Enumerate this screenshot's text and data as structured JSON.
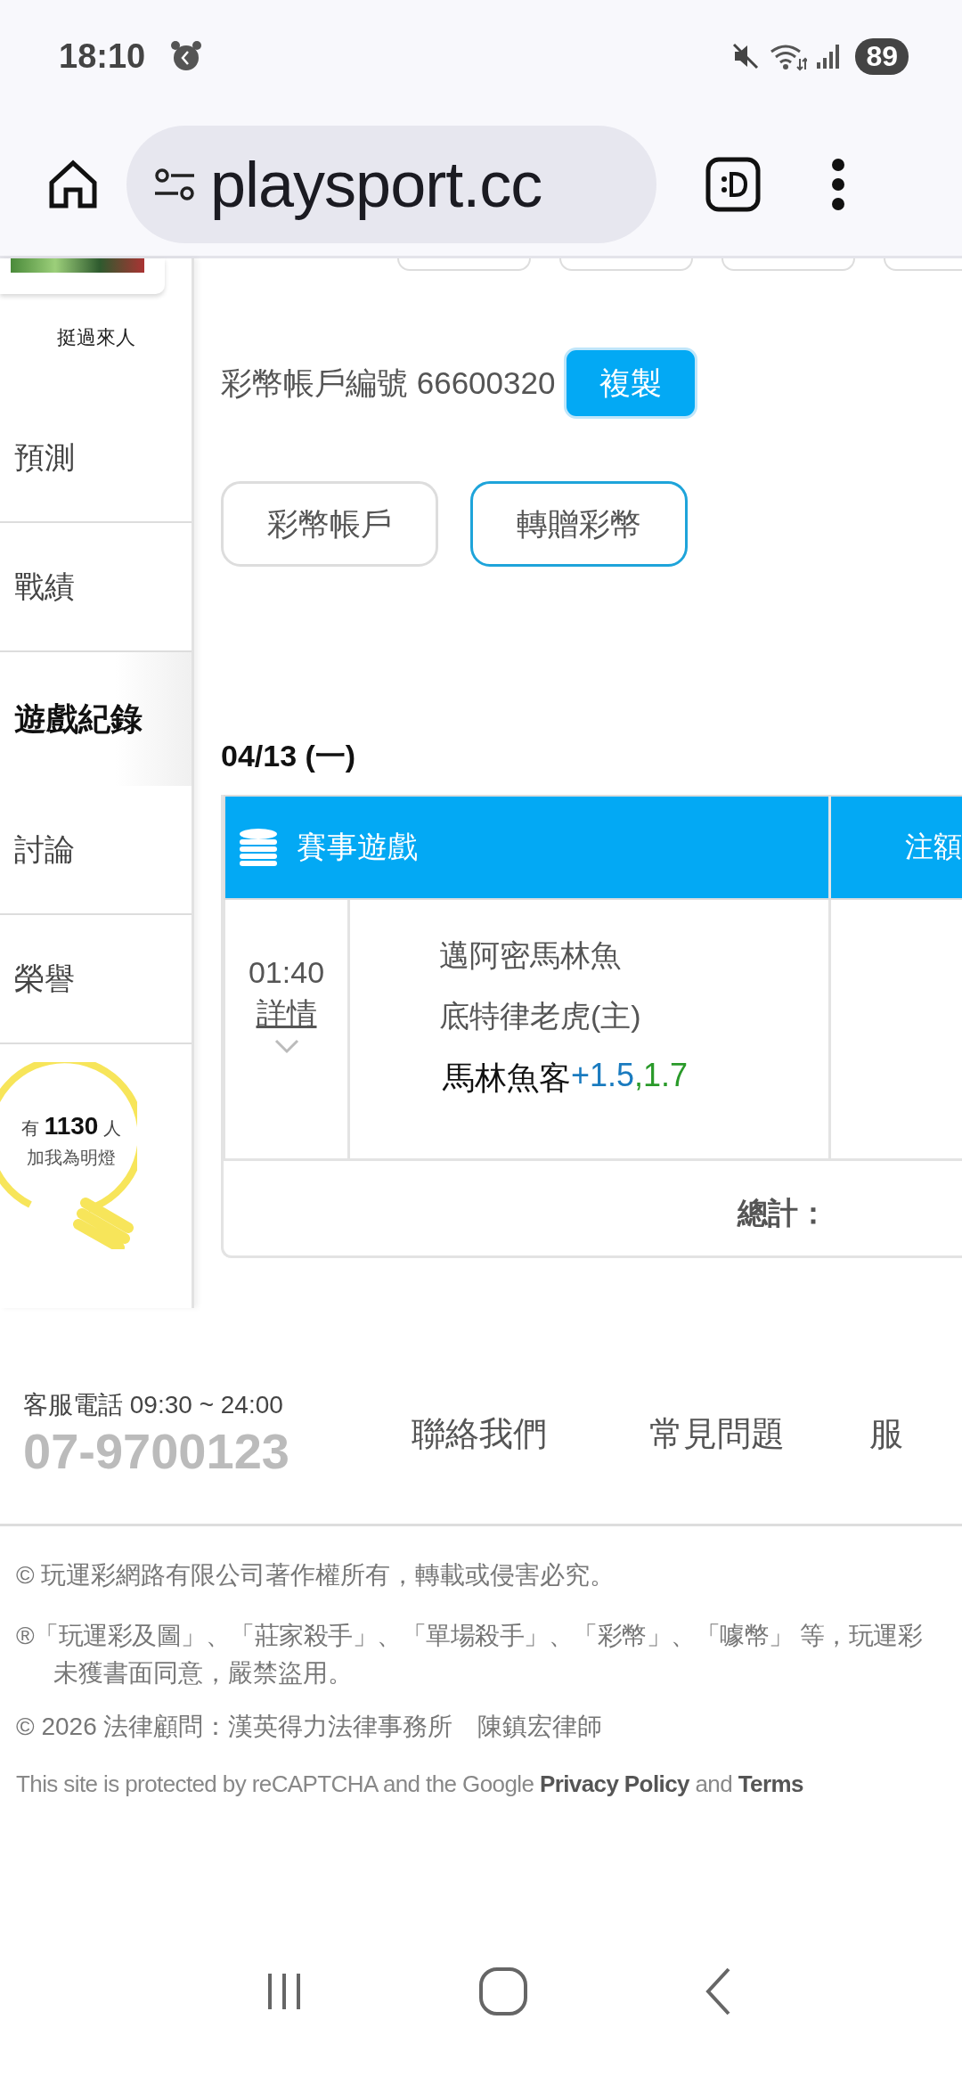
{
  "status_bar": {
    "time": "18:10",
    "battery": "89"
  },
  "browser": {
    "url": "playsport.cc"
  },
  "sidebar": {
    "profile_caption": "挺過來人",
    "items": [
      {
        "label": "預測",
        "selected": false
      },
      {
        "label": "戰績",
        "selected": false
      },
      {
        "label": "遊戲紀錄",
        "selected": true
      },
      {
        "label": "討論",
        "selected": false
      },
      {
        "label": "榮譽",
        "selected": false
      }
    ],
    "fans": {
      "prefix": "有",
      "count": "1130",
      "suffix": "人",
      "caption": "加我為明燈"
    }
  },
  "account": {
    "label": "彩幣帳戶編號 66600320",
    "copy_button": "複製",
    "tabs": [
      {
        "label": "彩幣帳戶",
        "selected": false
      },
      {
        "label": "轉贈彩幣",
        "selected": true
      }
    ]
  },
  "record": {
    "date": "04/13 (一)",
    "columns": [
      "賽事遊戲",
      "注額"
    ],
    "rows": [
      {
        "time": "01:40",
        "details_link": "詳情",
        "away": "邁阿密馬林魚",
        "home": "底特律老虎(主)",
        "pick": "馬林魚客",
        "handicap": "+1.5",
        "odds": ",1.7"
      }
    ],
    "total_label": "總計："
  },
  "footer": {
    "hotline_label": "客服電話 09:30 ~ 24:00",
    "phone": "07-9700123",
    "links": [
      "聯絡我們",
      "常見問題",
      "服"
    ],
    "notices": [
      "© 玩運彩網路有限公司著作權所有，轉載或侵害必究。",
      "®「玩運彩及圖」、「莊家殺手」、「單場殺手」、「彩幣」、「噱幣」 等，玩運彩",
      "未獲書面同意，嚴禁盜用。",
      "© 2026 法律顧問：漢英得力法律事務所　陳鎮宏律師"
    ],
    "recaptcha": "This site is protected by reCAPTCHA and the Google **Privacy Policy** and **Terms**"
  }
}
